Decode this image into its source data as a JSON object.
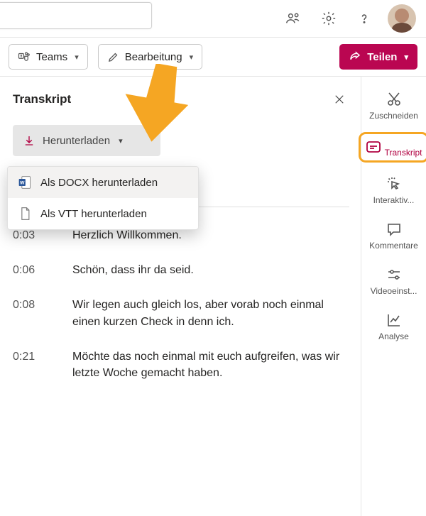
{
  "topbar": {
    "search_placeholder": ""
  },
  "actionbar": {
    "teams_label": "Teams",
    "edit_label": "Bearbeitung",
    "share_label": "Teilen"
  },
  "panel": {
    "title": "Transkript",
    "download_label": "Herunterladen",
    "menu": {
      "docx": "Als DOCX herunterladen",
      "vtt": "Als VTT herunterladen"
    }
  },
  "transcript": [
    {
      "time": "0:03",
      "text": "Herzlich Willkommen."
    },
    {
      "time": "0:06",
      "text": "Schön, dass ihr da seid."
    },
    {
      "time": "0:08",
      "text": "Wir legen auch gleich los, aber vorab noch einmal einen kurzen Check in denn ich."
    },
    {
      "time": "0:21",
      "text": "Möchte das noch einmal mit euch aufgreifen, was wir letzte Woche gemacht haben."
    }
  ],
  "rail": {
    "cut": "Zuschneiden",
    "transcript": "Transkript",
    "interactive": "Interaktiv...",
    "comments": "Kommentare",
    "videosettings": "Videoeinst...",
    "analytics": "Analyse"
  },
  "colors": {
    "accent": "#ba0651",
    "annotation": "#f5a623"
  }
}
